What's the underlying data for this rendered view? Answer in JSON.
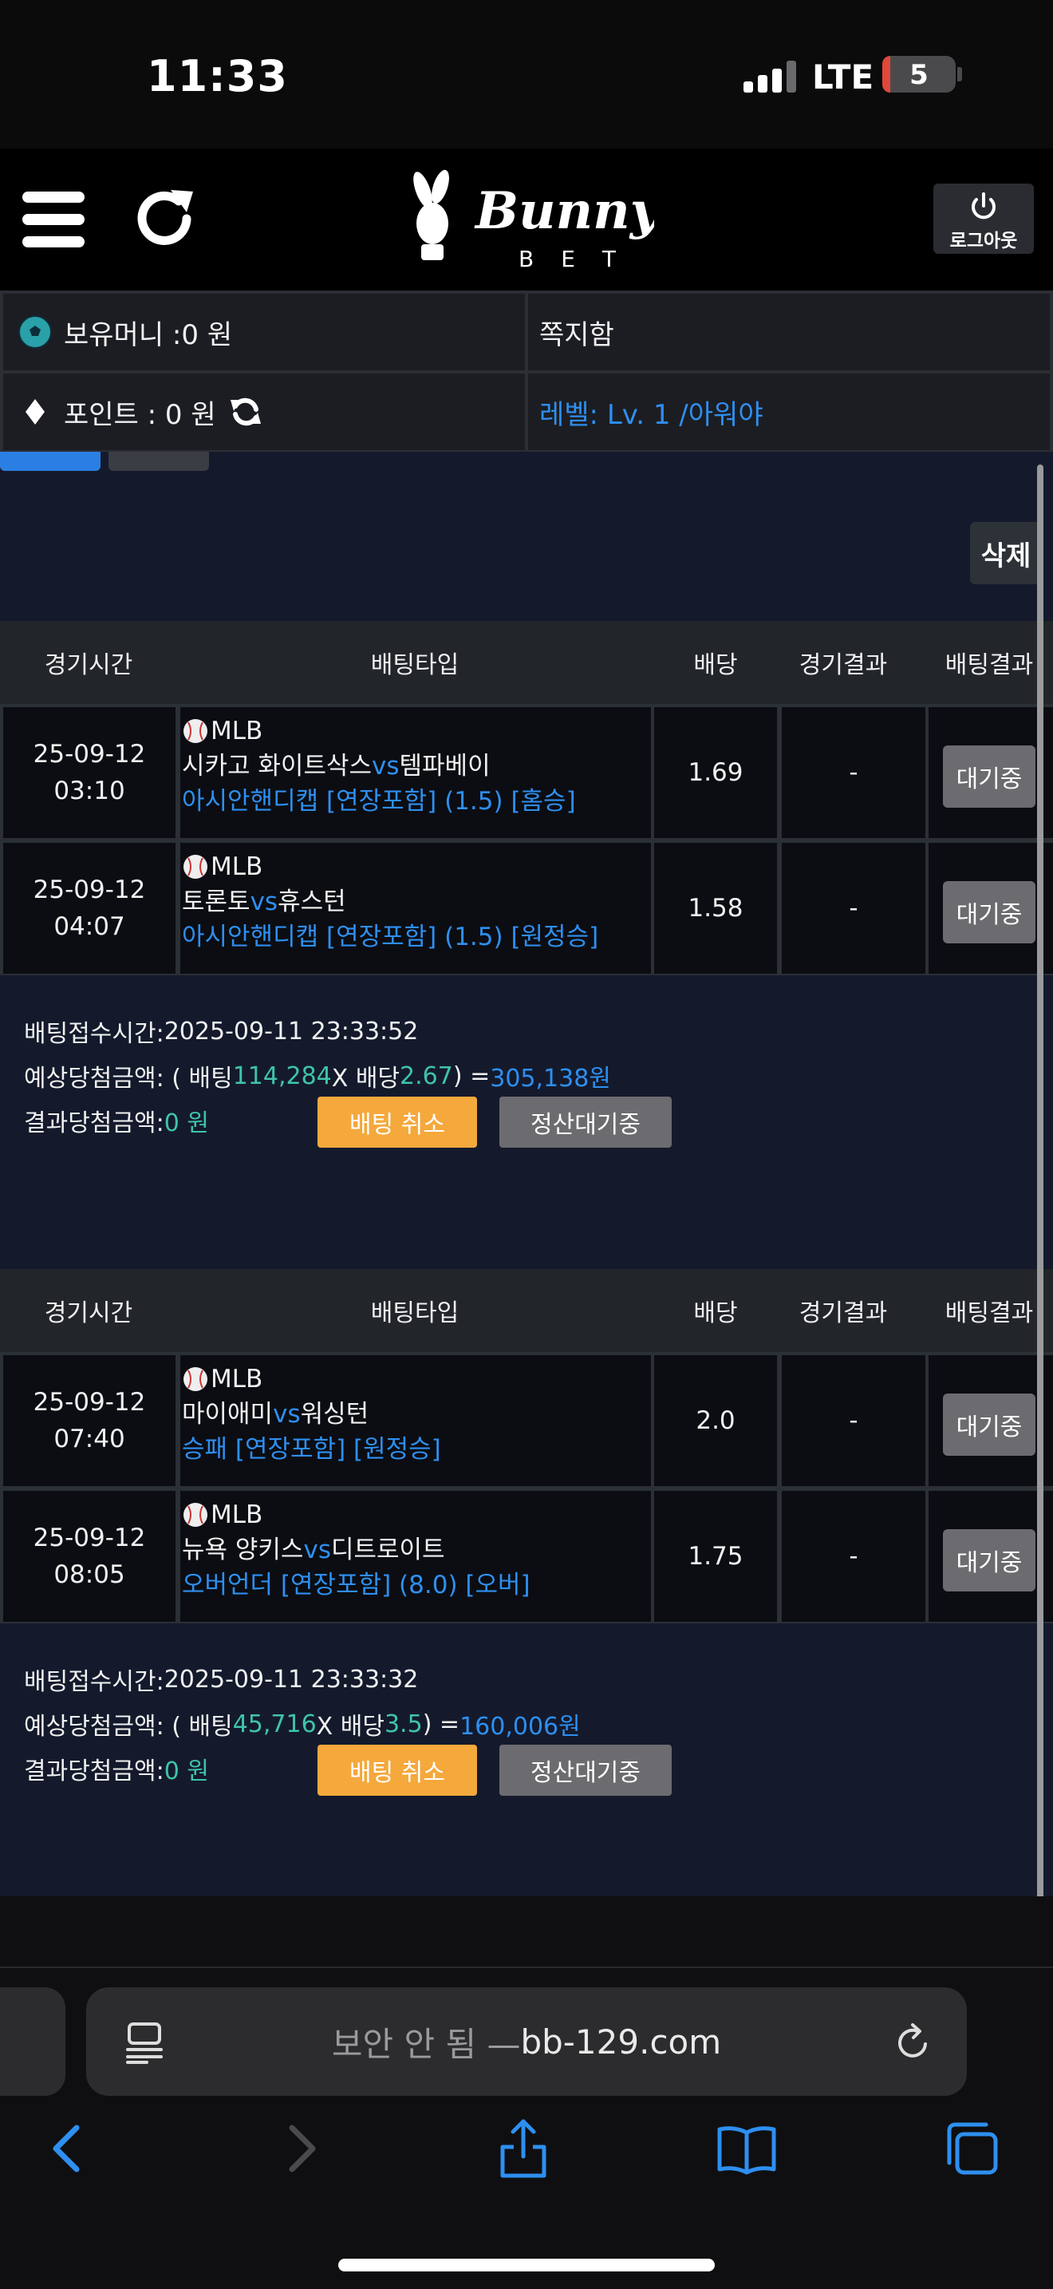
{
  "status_bar": {
    "time": "11:33",
    "network": "LTE",
    "battery": "5"
  },
  "header": {
    "logo_text": "Bunny",
    "logo_sub": "BET",
    "logout_label": "로그아웃"
  },
  "info": {
    "money": "보유머니 :0 원",
    "messages": "쪽지함",
    "points": "포인트 :   0 원",
    "level": "레벨: Lv. 1 /아워야"
  },
  "actions": {
    "delete_label": "삭제"
  },
  "columns": [
    "경기시간",
    "배팅타입",
    "배당",
    "경기결과",
    "배팅결과"
  ],
  "slips": [
    {
      "rows": [
        {
          "date": "25-09-12",
          "time": "03:10",
          "league": "MLB",
          "home": "시카고 화이트삭스",
          "vs": "vs",
          "away": "템파베이",
          "market": "아시안핸디캡 [연장포함] (1.5) [홈승]",
          "odds": "1.69",
          "result": "-",
          "bet_result": "대기중"
        },
        {
          "date": "25-09-12",
          "time": "04:07",
          "league": "MLB",
          "home": "토론토",
          "vs": "vs",
          "away": "휴스턴",
          "market": "아시안핸디캡 [연장포함] (1.5) [원정승]",
          "odds": "1.58",
          "result": "-",
          "bet_result": "대기중"
        }
      ],
      "summary": {
        "received_label": "배팅접수시간: ",
        "received": "2025-09-11 23:33:52",
        "expected_label": "예상당첨금액: ( 배팅 ",
        "stake": "114,284",
        "x_label": " X 배당 ",
        "odds": "2.67",
        "eq_label": " ) = ",
        "payout": "305,138원",
        "result_label": "결과당첨금액: ",
        "result_amount": "0 원",
        "cancel_label": "배팅 취소",
        "pending_label": "정산대기중"
      }
    },
    {
      "rows": [
        {
          "date": "25-09-12",
          "time": "07:40",
          "league": "MLB",
          "home": "마이애미",
          "vs": "vs",
          "away": "워싱턴",
          "market": "승패 [연장포함] [원정승]",
          "odds": "2.0",
          "result": "-",
          "bet_result": "대기중"
        },
        {
          "date": "25-09-12",
          "time": "08:05",
          "league": "MLB",
          "home": "뉴욕 양키스",
          "vs": "vs",
          "away": "디트로이트",
          "market": "오버언더 [연장포함] (8.0) [오버]",
          "odds": "1.75",
          "result": "-",
          "bet_result": "대기중"
        }
      ],
      "summary": {
        "received_label": "배팅접수시간: ",
        "received": "2025-09-11 23:33:32",
        "expected_label": "예상당첨금액: ( 배팅 ",
        "stake": "45,716",
        "x_label": " X 배당 ",
        "odds": "3.5",
        "eq_label": " ) = ",
        "payout": "160,006원",
        "result_label": "결과당첨금액: ",
        "result_amount": "0 원",
        "cancel_label": "배팅 취소",
        "pending_label": "정산대기중"
      }
    }
  ],
  "browser": {
    "insecure_label": "보안 안 됨 — ",
    "domain": "bb-129.com"
  },
  "colors": {
    "accent_blue": "#2e8ff0",
    "teal": "#3fc4a8",
    "cancel_orange": "#f5a83c",
    "panel": "#141a2c"
  }
}
